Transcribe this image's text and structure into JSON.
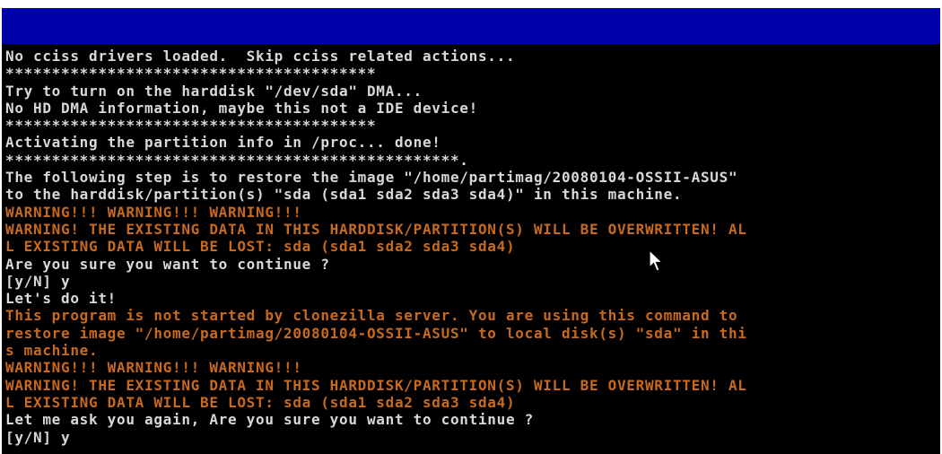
{
  "colors": {
    "background": "#000000",
    "header_bar": "#0000a8",
    "normal_text": "#d8d8d8",
    "warning_text": "#c86a1e"
  },
  "console": {
    "lines": [
      {
        "text": "No cciss drivers loaded.  Skip cciss related actions...",
        "style": "white"
      },
      {
        "text": "****************************************",
        "style": "white"
      },
      {
        "text": "Try to turn on the harddisk \"/dev/sda\" DMA...",
        "style": "white"
      },
      {
        "text": "No HD DMA information, maybe this not a IDE device!",
        "style": "white"
      },
      {
        "text": "****************************************",
        "style": "white"
      },
      {
        "text": "Activating the partition info in /proc... done!",
        "style": "white"
      },
      {
        "text": "*************************************************.",
        "style": "white"
      },
      {
        "text": "The following step is to restore the image \"/home/partimag/20080104-OSSII-ASUS\"",
        "style": "white"
      },
      {
        "text": "to the harddisk/partition(s) \"sda (sda1 sda2 sda3 sda4)\" in this machine.",
        "style": "white"
      },
      {
        "text": "WARNING!!! WARNING!!! WARNING!!!",
        "style": "orange"
      },
      {
        "text": "WARNING! THE EXISTING DATA IN THIS HARDDISK/PARTITION(S) WILL BE OVERWRITTEN! AL",
        "style": "orange"
      },
      {
        "text": "L EXISTING DATA WILL BE LOST: sda (sda1 sda2 sda3 sda4)",
        "style": "orange"
      },
      {
        "text": "Are you sure you want to continue ?",
        "style": "white"
      },
      {
        "text": "[y/N] y",
        "style": "white"
      },
      {
        "text": "Let's do it!",
        "style": "white"
      },
      {
        "text": "This program is not started by clonezilla server. You are using this command to",
        "style": "orange"
      },
      {
        "text": "restore image \"/home/partimag/20080104-OSSII-ASUS\" to local disk(s) \"sda\" in thi",
        "style": "orange"
      },
      {
        "text": "s machine.",
        "style": "orange"
      },
      {
        "text": "WARNING!!! WARNING!!! WARNING!!!",
        "style": "orange"
      },
      {
        "text": "WARNING! THE EXISTING DATA IN THIS HARDDISK/PARTITION(S) WILL BE OVERWRITTEN! AL",
        "style": "orange"
      },
      {
        "text": "L EXISTING DATA WILL BE LOST: sda (sda1 sda2 sda3 sda4)",
        "style": "orange"
      },
      {
        "text": "Let me ask you again, Are you sure you want to continue ?",
        "style": "white"
      },
      {
        "text": "[y/N] y",
        "style": "white"
      }
    ]
  },
  "cursor": {
    "icon": "mouse-pointer-icon"
  }
}
